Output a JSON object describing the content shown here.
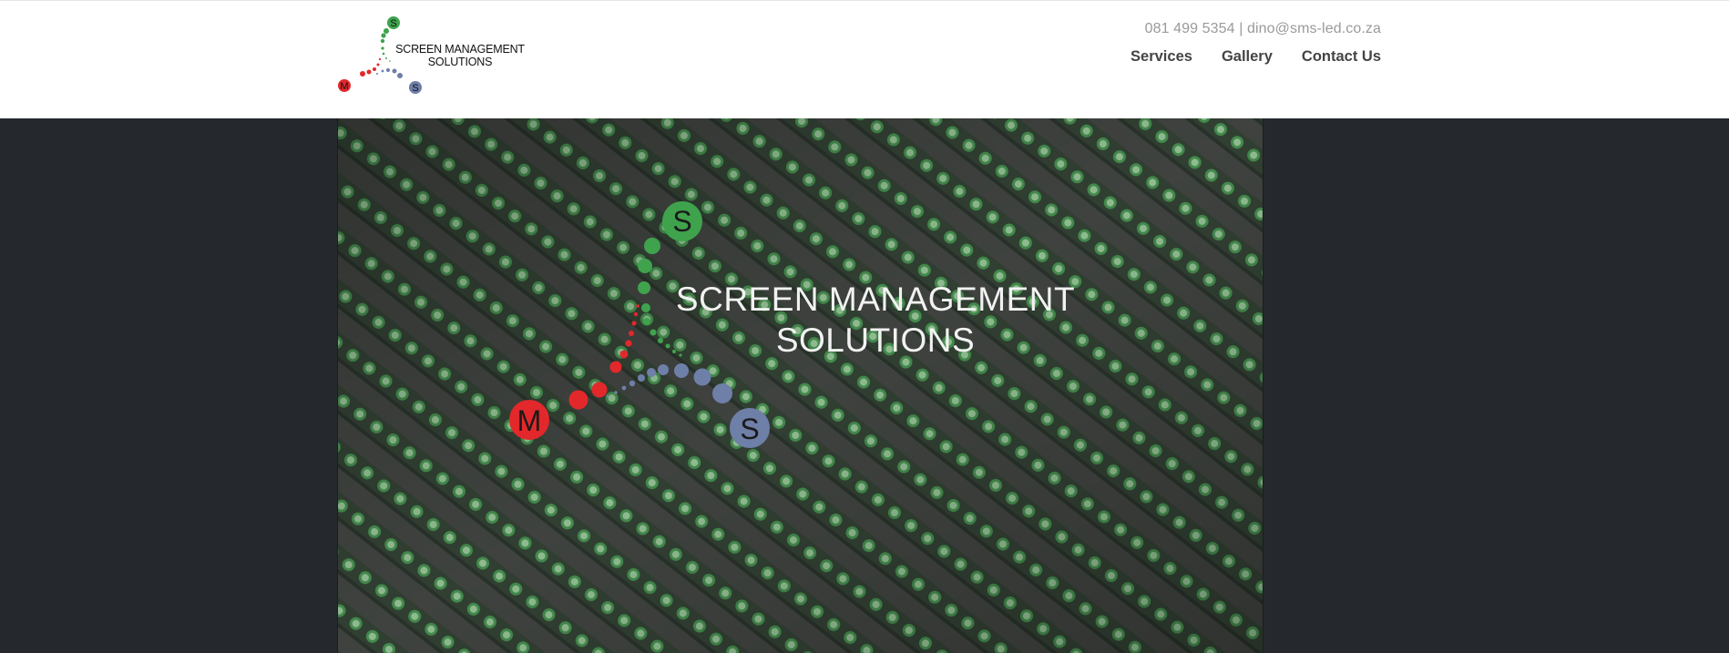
{
  "header": {
    "logo": {
      "letters": {
        "top": "S",
        "left": "M",
        "right": "S"
      },
      "line1": "SCREEN MANAGEMENT",
      "line2": "SOLUTIONS"
    },
    "contact": "081 499 5354 | dino@sms-led.co.za",
    "nav": [
      {
        "label": "Services"
      },
      {
        "label": "Gallery"
      },
      {
        "label": "Contact Us"
      }
    ]
  },
  "hero": {
    "letters": {
      "top": "S",
      "left": "M",
      "right": "S"
    },
    "title_line1": "SCREEN MANAGEMENT",
    "title_line2": "SOLUTIONS"
  },
  "colors": {
    "green": "#3fa34d",
    "red": "#e2282b",
    "blue": "#6e7fa8",
    "header_bg": "#ffffff",
    "page_bg": "#25292e"
  }
}
